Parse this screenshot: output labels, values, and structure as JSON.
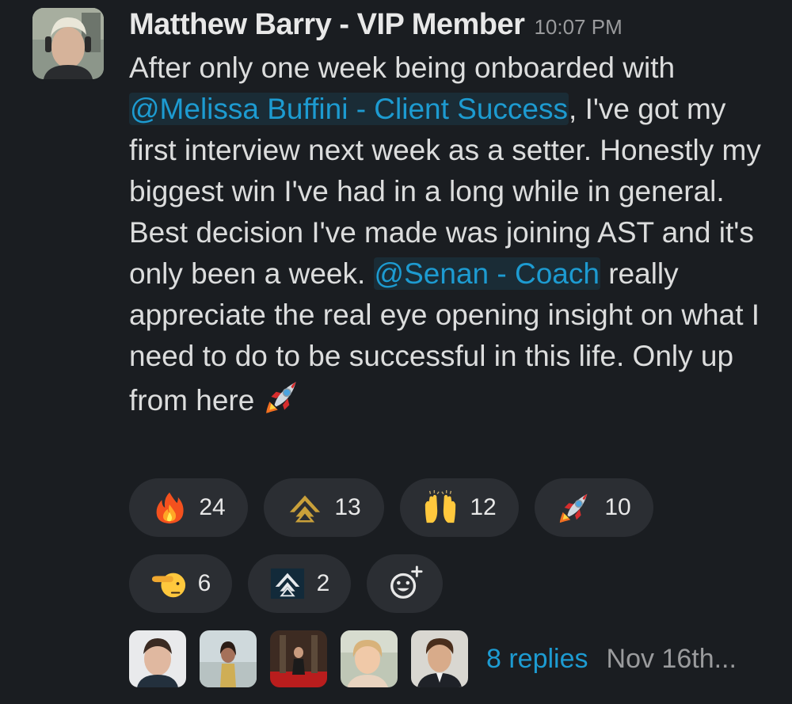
{
  "message": {
    "author": "Matthew Barry - VIP Member",
    "time": "10:07 PM",
    "text_1": "After only one week being onboarded with ",
    "mention_1": "@Melissa Buffini - Client Success",
    "text_2": ", I've got my first interview next week as a setter. Honestly my biggest win I've had in a long while in general. Best decision I've made was joining AST and it's only been a week. ",
    "mention_2": "@Senan - Coach",
    "text_3": " really appreciate the real eye opening insight on what I need to do to be successful in this life. Only up from here ",
    "inline_emoji": "rocket-icon"
  },
  "reactions": [
    {
      "icon": "fire-icon",
      "count": "24"
    },
    {
      "icon": "ast-gold-logo-icon",
      "count": "13"
    },
    {
      "icon": "raised-hands-icon",
      "count": "12"
    },
    {
      "icon": "rocket-icon",
      "count": "10"
    },
    {
      "icon": "saluting-face-icon",
      "count": "6"
    },
    {
      "icon": "ast-dark-logo-icon",
      "count": "2"
    },
    {
      "icon": "add-reaction-icon",
      "count": ""
    }
  ],
  "thread": {
    "replies": "8 replies",
    "date": "Nov 16th..."
  },
  "colors": {
    "background": "#1a1d21",
    "mention": "#1d9bd1",
    "pill": "#2b2e33",
    "muted": "#9a9b9d"
  }
}
